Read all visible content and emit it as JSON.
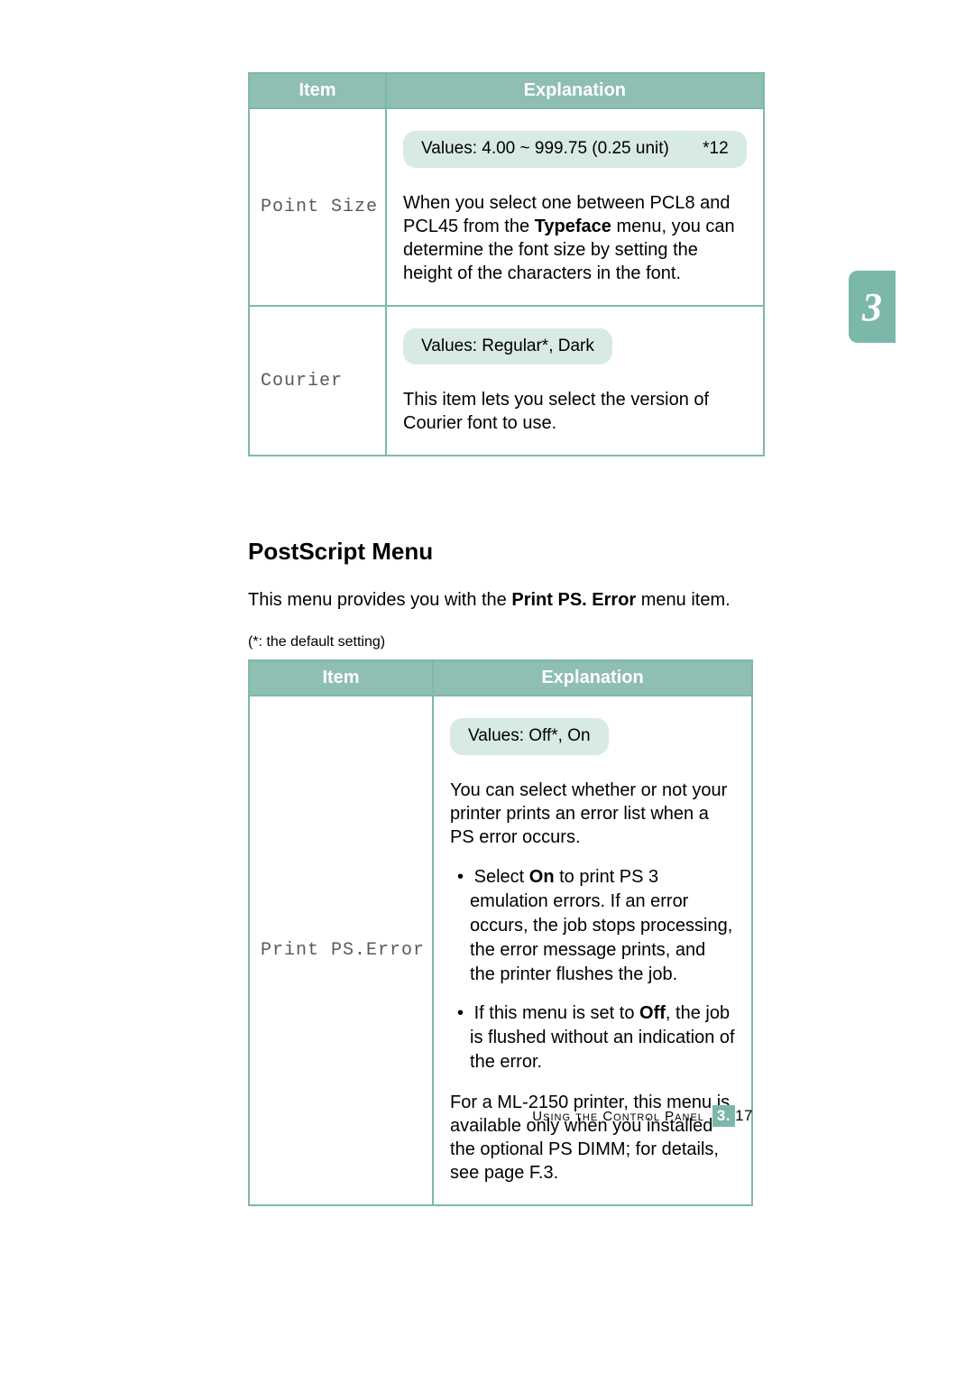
{
  "side_tab": "3",
  "table1": {
    "header_item": "Item",
    "header_exp": "Explanation",
    "rows": [
      {
        "item": "Point Size",
        "values": "Values: 4.00 ~ 999.75 (0.25 unit)",
        "values_default": "*12",
        "desc_pre": "When you select one between PCL8 and PCL45 from the ",
        "desc_bold": "Typeface",
        "desc_post": " menu, you can determine the font size by setting the height of the characters in the font."
      },
      {
        "item": "Courier",
        "values": "Values: Regular*, Dark",
        "desc": "This item lets you select the version of Courier font to use."
      }
    ]
  },
  "section": {
    "heading": "PostScript Menu",
    "intro_pre": "This menu provides you with the ",
    "intro_bold": "Print PS. Error",
    "intro_post": " menu item.",
    "footnote": "(*: the default setting)"
  },
  "table2": {
    "header_item": "Item",
    "header_exp": "Explanation",
    "row": {
      "item": "Print PS.Error",
      "values": "Values: Off*, On",
      "desc1": "You can select whether or not your printer prints an error list when a PS error occurs.",
      "bullet1_pre": "Select ",
      "bullet1_bold": "On",
      "bullet1_post": " to print PS 3 emulation errors. If an error occurs, the job stops processing, the error message prints, and the printer flushes the job.",
      "bullet2_pre": "If this menu is set to ",
      "bullet2_bold": "Off",
      "bullet2_post": ", the job is flushed without an indication of the error.",
      "desc2": "For a ML-2150 printer, this menu is available only when you installed the optional PS DIMM; for details, see page F.3."
    }
  },
  "footer": {
    "label": "Using the Control Panel",
    "chapter": "3",
    "dot": ".",
    "page": "17"
  }
}
